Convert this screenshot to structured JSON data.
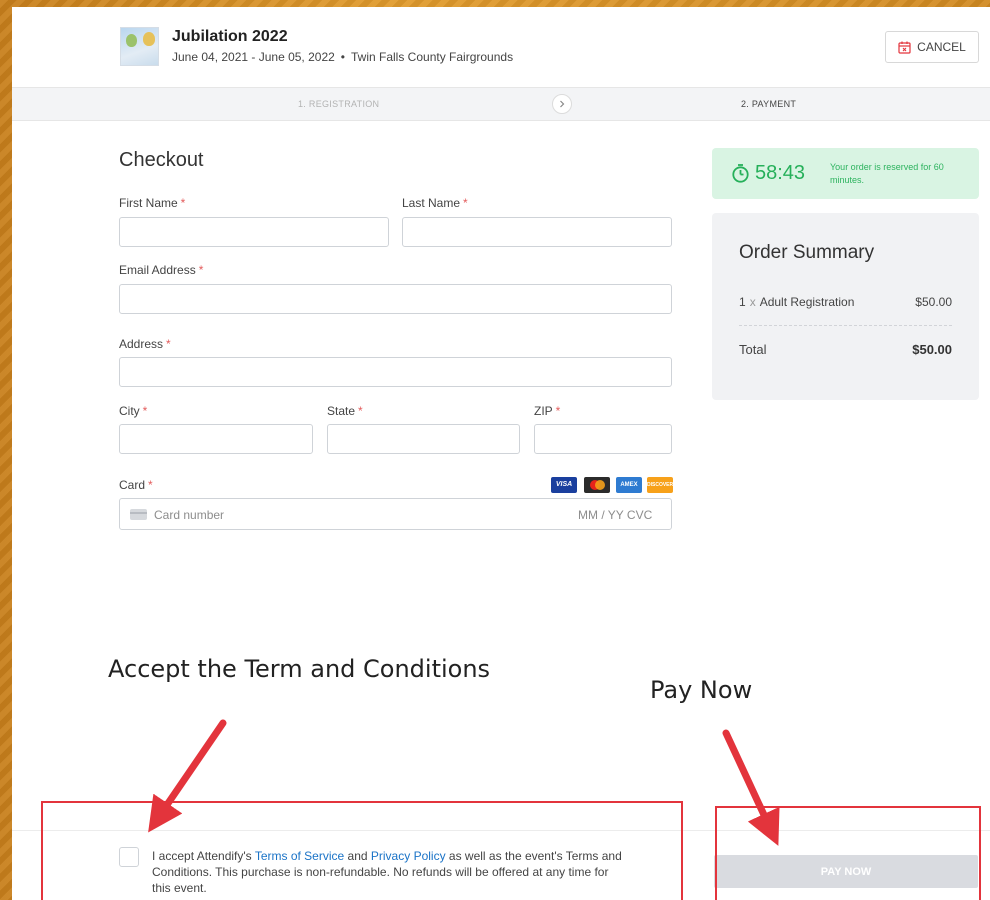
{
  "header": {
    "event_title": "Jubilation 2022",
    "event_dates": "June 04, 2021 - June 05, 2022",
    "event_separator": "•",
    "event_venue": "Twin Falls County Fairgrounds",
    "cancel_label": "CANCEL"
  },
  "steps": {
    "step1": "1. REGISTRATION",
    "step2": "2. PAYMENT"
  },
  "form": {
    "title": "Checkout",
    "required_mark": "*",
    "first_name_label": "First Name",
    "last_name_label": "Last Name",
    "email_label": "Email Address",
    "address_label": "Address",
    "city_label": "City",
    "state_label": "State",
    "zip_label": "ZIP",
    "card_label": "Card",
    "card_placeholder": "Card number",
    "card_exp_cvc": "MM / YY  CVC",
    "card_brands": [
      "VISA",
      "mastercard",
      "AMEX",
      "DISCOVER"
    ]
  },
  "timer": {
    "value": "58:43",
    "note": "Your order is reserved for 60 minutes.",
    "color": "#26b05a"
  },
  "summary": {
    "title": "Order Summary",
    "item_qty": "1",
    "item_x": "x",
    "item_name": "Adult Registration",
    "item_price": "$50.00",
    "total_label": "Total",
    "total_value": "$50.00"
  },
  "terms": {
    "prefix": "I accept Attendify's",
    "tos_link": "Terms of Service",
    "and": "and",
    "privacy_link": "Privacy Policy",
    "suffix": "as well as the event's Terms and Conditions. This purchase is non-refundable. No refunds will be offered at any time for this event.",
    "pay_label": "PAY NOW"
  },
  "annotations": {
    "accept_text": "Accept the Term and Conditions",
    "pay_text": "Pay Now",
    "color": "#e3343c"
  }
}
